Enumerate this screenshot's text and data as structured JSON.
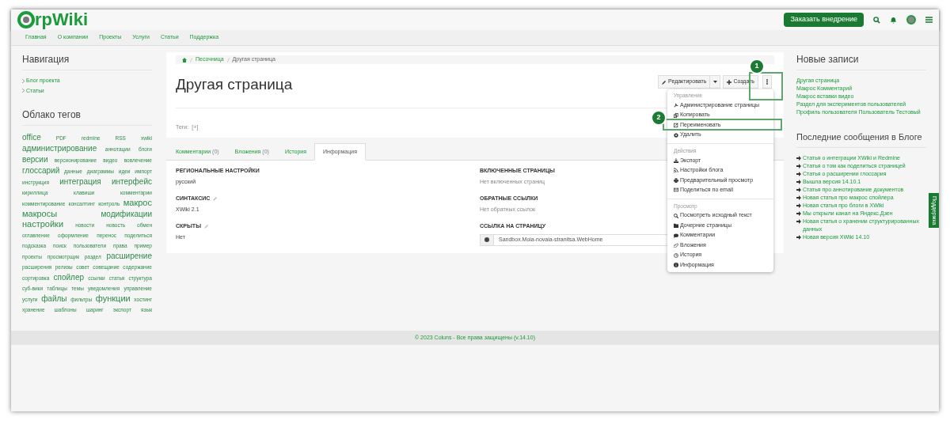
{
  "header": {
    "logo": "rpWiki",
    "order_button": "Заказать внедрение"
  },
  "nav": [
    "Главная",
    "О компании",
    "Проекты",
    "Услуги",
    "Статьи",
    "Поддержка"
  ],
  "left": {
    "navigation_title": "Навигация",
    "navigation_links": [
      "Блог проекта",
      "Статьи"
    ],
    "tags_title": "Облако тегов",
    "tags": [
      {
        "label": "office",
        "kind": "l"
      },
      {
        "label": "PDF",
        "kind": "s"
      },
      {
        "label": "redmine",
        "kind": "s"
      },
      {
        "label": "RSS",
        "kind": "s"
      },
      {
        "label": "xwiki",
        "kind": "s"
      },
      {
        "label": "администрирование",
        "kind": "l"
      },
      {
        "label": "аннотации",
        "kind": "s"
      },
      {
        "label": "блоги",
        "kind": "s"
      },
      {
        "label": "версии",
        "kind": "l"
      },
      {
        "label": "версионирование",
        "kind": "s"
      },
      {
        "label": "видео",
        "kind": "s"
      },
      {
        "label": "вовлечение",
        "kind": "s"
      },
      {
        "label": "глоссарий",
        "kind": "l"
      },
      {
        "label": "данные",
        "kind": "s"
      },
      {
        "label": "диаграммы",
        "kind": "s"
      },
      {
        "label": "идеи",
        "kind": "s"
      },
      {
        "label": "импорт",
        "kind": "s"
      },
      {
        "label": "инструкция",
        "kind": "s"
      },
      {
        "label": "интеграция",
        "kind": "l"
      },
      {
        "label": "интерфейс",
        "kind": "l"
      },
      {
        "label": "кириллица",
        "kind": "s"
      },
      {
        "label": "клавиши",
        "kind": "s"
      },
      {
        "label": "комментарии",
        "kind": "s"
      },
      {
        "label": "комментирование",
        "kind": "s"
      },
      {
        "label": "консалтинг",
        "kind": "s"
      },
      {
        "label": "контроль",
        "kind": "s"
      },
      {
        "label": "макрос",
        "kind": "xl"
      },
      {
        "label": "макросы",
        "kind": "xl"
      },
      {
        "label": "модификации",
        "kind": "l"
      },
      {
        "label": "настройки",
        "kind": "xl"
      },
      {
        "label": "новости",
        "kind": "s"
      },
      {
        "label": "новость",
        "kind": "s"
      },
      {
        "label": "обмен",
        "kind": "s"
      },
      {
        "label": "оглавление",
        "kind": "s"
      },
      {
        "label": "оформление",
        "kind": "s"
      },
      {
        "label": "перенос",
        "kind": "s"
      },
      {
        "label": "поделиться",
        "kind": "s"
      },
      {
        "label": "подсказка",
        "kind": "s"
      },
      {
        "label": "поиск",
        "kind": "s"
      },
      {
        "label": "пользователи",
        "kind": "s"
      },
      {
        "label": "права",
        "kind": "s"
      },
      {
        "label": "пример",
        "kind": "s"
      },
      {
        "label": "проекты",
        "kind": "s"
      },
      {
        "label": "просмотрщик",
        "kind": "s"
      },
      {
        "label": "раздел",
        "kind": "s"
      },
      {
        "label": "расширение",
        "kind": "l"
      },
      {
        "label": "расширения",
        "kind": "s"
      },
      {
        "label": "релизы",
        "kind": "s"
      },
      {
        "label": "совет",
        "kind": "s"
      },
      {
        "label": "совещание",
        "kind": "s"
      },
      {
        "label": "содержание",
        "kind": "s"
      },
      {
        "label": "сортировка",
        "kind": "s"
      },
      {
        "label": "спойлер",
        "kind": "l"
      },
      {
        "label": "ссылки",
        "kind": "s"
      },
      {
        "label": "статья",
        "kind": "s"
      },
      {
        "label": "структура",
        "kind": "s"
      },
      {
        "label": "суб-вики",
        "kind": "s"
      },
      {
        "label": "таблицы",
        "kind": "s"
      },
      {
        "label": "темы",
        "kind": "s"
      },
      {
        "label": "уведомления",
        "kind": "s"
      },
      {
        "label": "управление",
        "kind": "s"
      },
      {
        "label": "услуги",
        "kind": "s"
      },
      {
        "label": "файлы",
        "kind": "l"
      },
      {
        "label": "фильтры",
        "kind": "s"
      },
      {
        "label": "функции",
        "kind": "xl"
      },
      {
        "label": "хостинг",
        "kind": "s"
      },
      {
        "label": "хранение",
        "kind": "s"
      },
      {
        "label": "шаблоны",
        "kind": "s"
      },
      {
        "label": "шаринг",
        "kind": "s"
      },
      {
        "label": "экспорт",
        "kind": "s"
      },
      {
        "label": "язык",
        "kind": "s"
      }
    ]
  },
  "breadcrumb": [
    "Песочница",
    "Другая страница"
  ],
  "page_title": "Другая страница",
  "actions": {
    "edit": "Редактировать",
    "create": "Создать"
  },
  "tags_label": "Теги:",
  "tags_add": "[+]",
  "tabs": [
    {
      "label": "Комментарии",
      "count": "(0)",
      "selected": false
    },
    {
      "label": "Вложения",
      "count": "(0)",
      "selected": false
    },
    {
      "label": "История",
      "selected": false
    },
    {
      "label": "Информация",
      "selected": true
    }
  ],
  "info_left": [
    {
      "label": "РЕГИОНАЛЬНЫЕ НАСТРОЙКИ",
      "value": "русский",
      "editable": false
    },
    {
      "label": "СИНТАКСИС",
      "value": "XWiki 2.1",
      "editable": true
    },
    {
      "label": "СКРЫТЫ",
      "value": "Нет",
      "editable": true
    }
  ],
  "info_right": [
    {
      "label": "ВКЛЮЧЕННЫЕ СТРАНИЦЫ",
      "value": "Нет включенных страниц"
    },
    {
      "label": "ОБРАТНЫЕ ССЫЛКИ",
      "value": "Нет обратных ссылок"
    }
  ],
  "page_link": {
    "label": "ССЫЛКА НА СТРАНИЦУ",
    "value": "Sandbox.Moia-novaia-stranitsa.WebHome"
  },
  "menu": [
    {
      "header": "Управление",
      "items": [
        "Администрирование страницы",
        "Копировать",
        "Переименовать",
        "Удалить"
      ]
    },
    {
      "header": "Действия",
      "items": [
        "Экспорт",
        "Настройки блога",
        "Предварительный просмотр",
        "Поделиться по email"
      ]
    },
    {
      "header": "Просмотр",
      "items": [
        "Посмотреть исходный текст",
        "Дочерние страницы",
        "Комментарии",
        "Вложения",
        "История",
        "Информация"
      ]
    }
  ],
  "right": {
    "new_title": "Новые записи",
    "new_links": [
      "Другая страница",
      "Макрос Комментарий",
      "Макрос вставки видео",
      "Раздел для экспериментов пользователей",
      "Профиль пользователя Пользователь Тестовый"
    ],
    "blog_title": "Последние сообщения в Блоге",
    "blog_links": [
      "Статья о интеграции XWiki и Redmine",
      "Статья о том как поделиться страницей",
      "Статья о расширении глоссария",
      "Вышла версия 14.10.1",
      "Статья про аннотирование документов",
      "Новая статья про макрос спойлера",
      "Новая статья про блоги в XWiki",
      "Мы открыли канал на Яндекс.Дзен",
      "Новая статья о хранении структурированных данных",
      "Новая версия XWiki 14.10"
    ]
  },
  "support_tab": "Поддержка",
  "footer": "© 2023 Coluns - Все права защищены (v.14.10)",
  "annotations": [
    {
      "number": "1"
    },
    {
      "number": "2"
    }
  ]
}
